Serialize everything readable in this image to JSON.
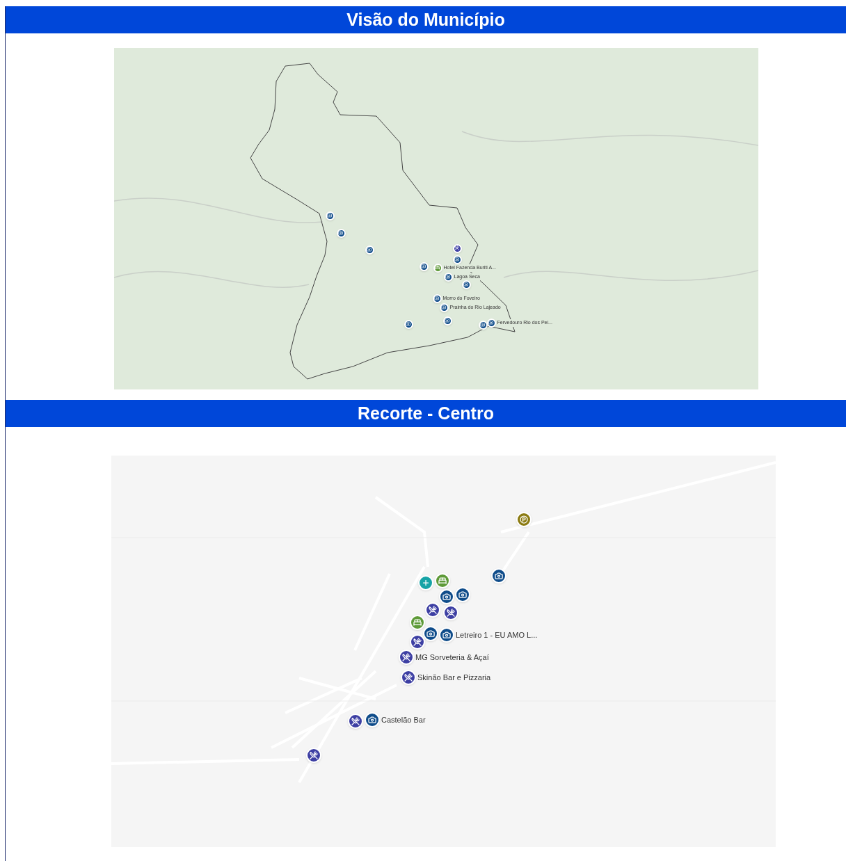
{
  "sections": [
    {
      "title": "Visão do Município",
      "map": {
        "markers": [
          {
            "kind": "camera"
          },
          {
            "kind": "camera"
          },
          {
            "kind": "camera"
          },
          {
            "kind": "camera"
          },
          {
            "kind": "food"
          },
          {
            "kind": "camera"
          },
          {
            "kind": "hotel",
            "label": "Hotel Fazenda Buriti A..."
          },
          {
            "kind": "camera",
            "label": "Lagoa Seca"
          },
          {
            "kind": "camera"
          },
          {
            "kind": "camera",
            "label": "Morro do Foveiro"
          },
          {
            "kind": "camera",
            "label": "Prainha do Rio Lajeado"
          },
          {
            "kind": "camera"
          },
          {
            "kind": "camera"
          },
          {
            "kind": "camera"
          },
          {
            "kind": "camera",
            "label": "Fervedouro Rio dos Pei..."
          }
        ]
      }
    },
    {
      "title": "Recorte - Centro",
      "map": {
        "markers": [
          {
            "kind": "parking"
          },
          {
            "kind": "camera"
          },
          {
            "kind": "health"
          },
          {
            "kind": "hotel"
          },
          {
            "kind": "camera"
          },
          {
            "kind": "camera"
          },
          {
            "kind": "food"
          },
          {
            "kind": "hotel"
          },
          {
            "kind": "camera"
          },
          {
            "kind": "food"
          },
          {
            "kind": "food"
          },
          {
            "kind": "camera",
            "label": "Letreiro 1 - EU AMO L..."
          },
          {
            "kind": "food",
            "label": "MG Sorveteria & Açaí"
          },
          {
            "kind": "food",
            "label": "Skinão Bar e Pizzaria"
          },
          {
            "kind": "food"
          },
          {
            "kind": "camera",
            "label": "Castelão Bar"
          },
          {
            "kind": "food"
          }
        ]
      }
    }
  ]
}
